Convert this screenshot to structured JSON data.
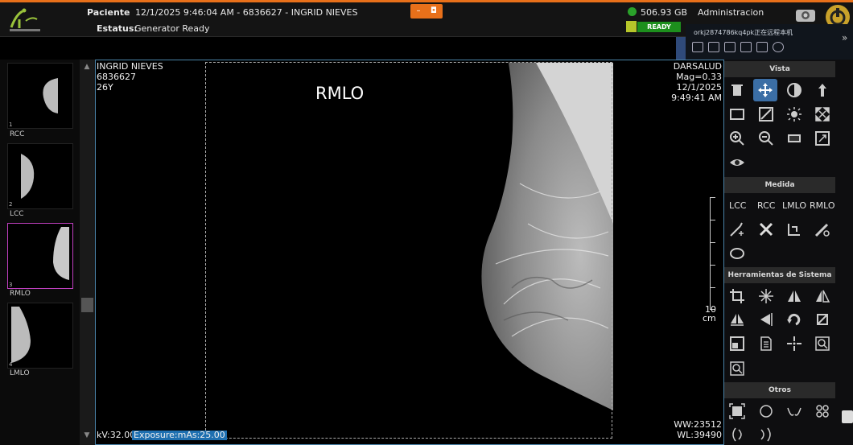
{
  "header": {
    "patient_label": "Paciente",
    "patient_value": "12/1/2025 9:46:04 AM - 6836627 - INGRID NIEVES",
    "status_label": "Estatus:",
    "status_value": "Generator Ready",
    "disk_free": "506.93 GB",
    "user": "Administracion",
    "ready_badge": "READY"
  },
  "remote_session": {
    "text": "orkj2874786kq4pk正在远程本机"
  },
  "thumbnails": [
    {
      "num": "1",
      "label": "RCC"
    },
    {
      "num": "2",
      "label": "LCC"
    },
    {
      "num": "3",
      "label": "RMLO"
    },
    {
      "num": "4",
      "label": "LMLO"
    }
  ],
  "viewer": {
    "patient_name": "INGRID NIEVES",
    "patient_id": "6836627",
    "age": "26Y",
    "institution": "DARSALUD",
    "mag": "Mag=0.33",
    "date": "12/1/2025",
    "time": "9:49:41 AM",
    "view_label": "RMLO",
    "scale": "10",
    "scale_unit": "cm",
    "kv": "kV:32.00",
    "exposure": "Exposure:mAs:25.00",
    "ww": "WW:23512",
    "wl": "WL:39490"
  },
  "panels": {
    "vista": "Vista",
    "medida": "Medida",
    "herramientas": "Herramientas de Sistema",
    "otros": "Otros"
  },
  "measure_views": [
    "LCC",
    "RCC",
    "LMLO",
    "RMLO"
  ],
  "colors": {
    "accent": "#e8701a",
    "selection": "#3b6ea5",
    "thumb_selected": "#c040c0",
    "ready_green": "#1d8f1d",
    "exposure_highlight": "#1e6fb0"
  }
}
